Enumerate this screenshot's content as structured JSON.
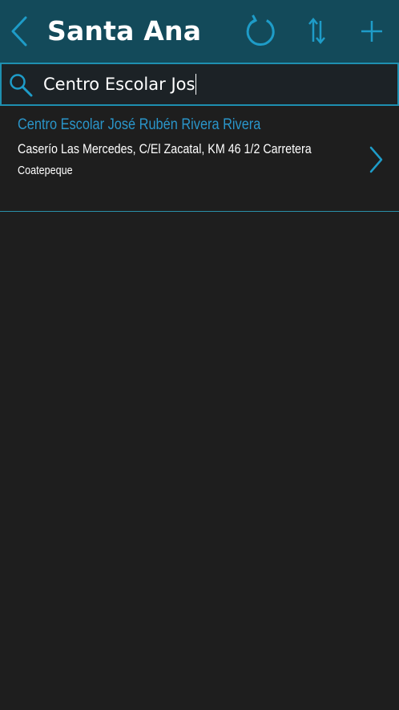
{
  "header": {
    "title": "Santa Ana",
    "back_icon": "chevron-left-icon",
    "refresh_icon": "refresh-icon",
    "sort_icon": "sort-icon",
    "add_icon": "plus-icon"
  },
  "search": {
    "value": "Centro Escolar Jos",
    "icon": "search-icon"
  },
  "results": [
    {
      "name": "Centro Escolar José Rubén Rivera Rivera",
      "address": "Caserío Las Mercedes, C/El Zacatal, KM 46 1/2 Carretera",
      "city": "Coatepeque"
    }
  ],
  "colors": {
    "header_bg": "#134a5a",
    "accent": "#1e8fb0",
    "link_text": "#2a95c9",
    "background": "#1e1e1e"
  }
}
